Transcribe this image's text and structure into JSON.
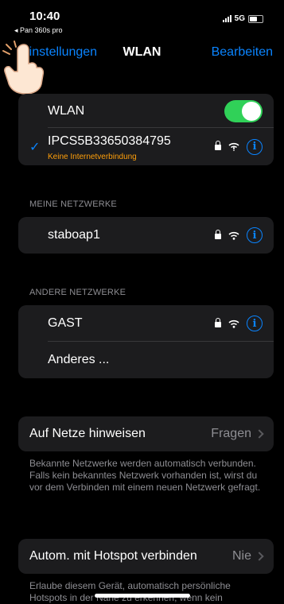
{
  "status": {
    "time": "10:40",
    "back_app": "◂ Pan 360s pro",
    "network": "5G"
  },
  "nav": {
    "back_label": "Einstellungen",
    "title": "WLAN",
    "edit_label": "Bearbeiten"
  },
  "wlan": {
    "label": "WLAN",
    "enabled": true,
    "connected_network": "IPCS5B33650384795",
    "connected_status": "Keine Internetverbindung"
  },
  "my_networks": {
    "header": "MEINE NETZWERKE",
    "items": [
      {
        "name": "staboap1"
      }
    ]
  },
  "other_networks": {
    "header": "ANDERE NETZWERKE",
    "items": [
      {
        "name": "GAST"
      }
    ],
    "other_label": "Anderes ..."
  },
  "ask_join": {
    "label": "Auf Netze hinweisen",
    "value": "Fragen",
    "footer": "Bekannte Netzwerke werden automatisch verbunden. Falls kein bekanntes Netzwerk vorhanden ist, wirst du vor dem Verbinden mit einem neuen Netzwerk gefragt."
  },
  "hotspot": {
    "label": "Autom. mit Hotspot verbinden",
    "value": "Nie",
    "footer": "Erlaube diesem Gerät, automatisch persönliche Hotspots in der Nähe zu erkennen, wenn kein"
  },
  "colors": {
    "accent": "#0a84ff",
    "toggle_on": "#30d158",
    "warning": "#ff9f0a",
    "group_bg": "#1c1c1e"
  }
}
